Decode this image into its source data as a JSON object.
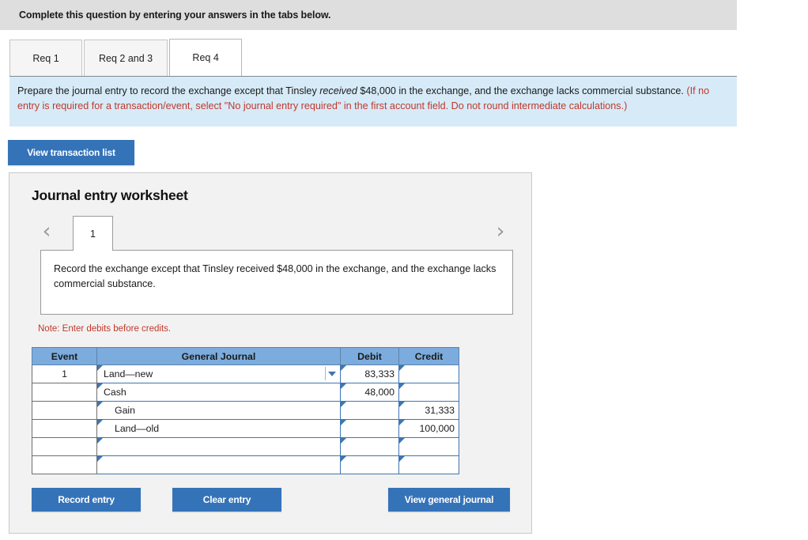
{
  "header": {
    "title": "Complete this question by entering your answers in the tabs below."
  },
  "tabs": [
    {
      "label": "Req 1",
      "active": false
    },
    {
      "label": "Req 2 and 3",
      "active": false
    },
    {
      "label": "Req 4",
      "active": true
    }
  ],
  "instructions": {
    "part1": "Prepare the journal entry to record the exchange except that Tinsley ",
    "emphasis": "received",
    "part2": " $48,000 in the exchange, and the exchange lacks commercial substance. ",
    "part3_red": "(If no entry is required for a transaction/event, select \"No journal entry required\" in the first account field. Do not round intermediate calculations.)"
  },
  "buttons": {
    "view_transaction_list": "View transaction list",
    "record_entry": "Record entry",
    "clear_entry": "Clear entry",
    "view_general_journal": "View general journal"
  },
  "worksheet": {
    "title": "Journal entry worksheet",
    "prev_icon": "chevron-left-icon",
    "next_icon": "chevron-right-icon",
    "page_tab": "1",
    "scenario": "Record the exchange except that Tinsley received $48,000 in the exchange, and the exchange lacks commercial substance.",
    "note": "Note: Enter debits before credits.",
    "table": {
      "headers": [
        "Event",
        "General Journal",
        "Debit",
        "Credit"
      ],
      "rows": [
        {
          "event": "1",
          "account": "Land—new",
          "indent": false,
          "debit": "83,333",
          "credit": "",
          "dropdown": true
        },
        {
          "event": "",
          "account": "Cash",
          "indent": false,
          "debit": "48,000",
          "credit": "",
          "dropdown": false
        },
        {
          "event": "",
          "account": "Gain",
          "indent": true,
          "debit": "",
          "credit": "31,333",
          "dropdown": false
        },
        {
          "event": "",
          "account": "Land—old",
          "indent": true,
          "debit": "",
          "credit": "100,000",
          "dropdown": false
        },
        {
          "event": "",
          "account": "",
          "indent": false,
          "debit": "",
          "credit": "",
          "dropdown": false
        },
        {
          "event": "",
          "account": "",
          "indent": false,
          "debit": "",
          "credit": "",
          "dropdown": false
        }
      ]
    }
  },
  "colors": {
    "accent_blue": "#3573b9",
    "table_header_blue": "#7cacdd",
    "instruction_panel_blue": "#d7eaf8",
    "header_gray": "#dedede",
    "alert_red": "#c0392b"
  }
}
